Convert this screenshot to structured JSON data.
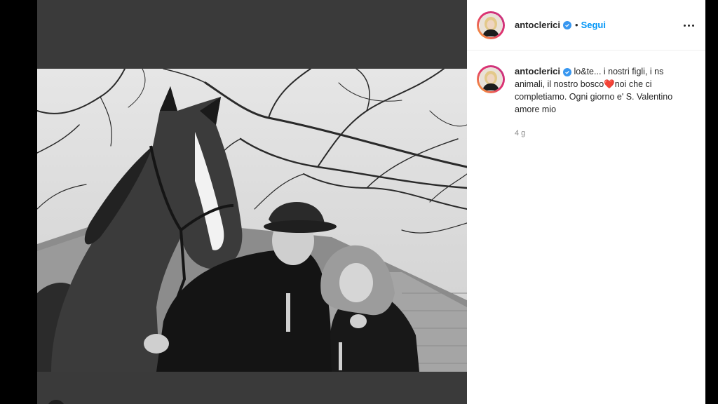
{
  "post": {
    "author": "antoclerici",
    "separator": "•",
    "follow_label": "Segui",
    "more_label": "…",
    "caption_before_emoji": "lo&te... i nostri figli, i ns animali, il nostro bosco",
    "emoji": "❤️",
    "caption_after_emoji": "noi che ci completiamo. Ogni giorno e' S. Valentino amore mio",
    "time_ago": "4 g"
  },
  "icons": {
    "verified": "verified-badge-icon",
    "more": "more-options-icon"
  },
  "colors": {
    "follow": "#0095f6",
    "verified": "#3897f0",
    "text": "#262626",
    "muted": "#8e8e8e",
    "heart": "#e0245e"
  }
}
